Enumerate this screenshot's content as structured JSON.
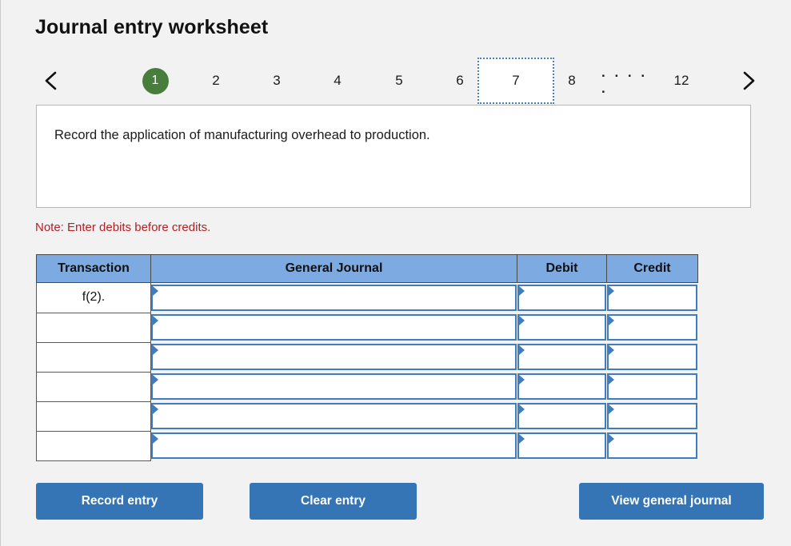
{
  "page": {
    "title": "Journal entry worksheet",
    "background_color": "#f2f2f2"
  },
  "pagination": {
    "prev_icon": "chevron-left-icon",
    "next_icon": "chevron-right-icon",
    "current_page": "1",
    "focused_page": "7",
    "ellipsis": ". . . . .",
    "accent_current_color": "#487e3c",
    "focus_border_color": "#4a7fc1",
    "pages": [
      "1",
      "2",
      "3",
      "4",
      "5",
      "6",
      "7",
      "8",
      "12"
    ]
  },
  "instruction": {
    "text": "Record the application of manufacturing overhead to production."
  },
  "note": {
    "text": "Note: Enter debits before credits.",
    "color": "#b32025"
  },
  "table": {
    "header_background": "#7eaae2",
    "columns": [
      "Transaction",
      "General Journal",
      "Debit",
      "Credit"
    ],
    "rows": [
      {
        "transaction": "f(2).",
        "general_journal": "",
        "debit": "",
        "credit": ""
      },
      {
        "transaction": "",
        "general_journal": "",
        "debit": "",
        "credit": ""
      },
      {
        "transaction": "",
        "general_journal": "",
        "debit": "",
        "credit": ""
      },
      {
        "transaction": "",
        "general_journal": "",
        "debit": "",
        "credit": ""
      },
      {
        "transaction": "",
        "general_journal": "",
        "debit": "",
        "credit": ""
      },
      {
        "transaction": "",
        "general_journal": "",
        "debit": "",
        "credit": ""
      }
    ]
  },
  "buttons": {
    "record_entry": "Record entry",
    "clear_entry": "Clear entry",
    "view_general_journal": "View general journal",
    "color": "#3575b5"
  }
}
